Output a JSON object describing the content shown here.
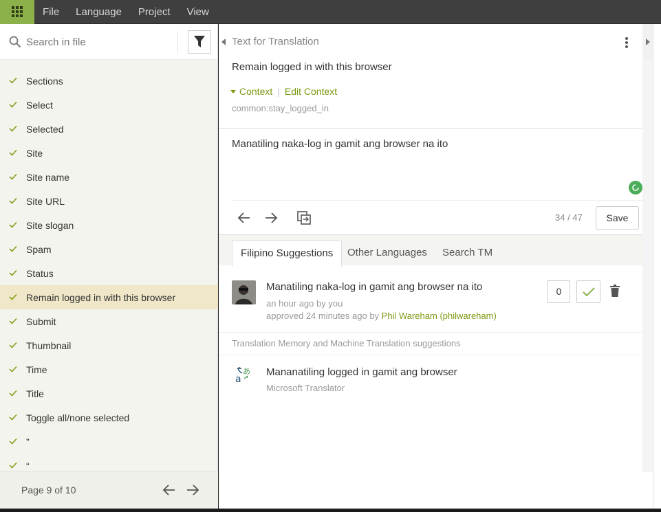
{
  "menubar": {
    "items": [
      "File",
      "Language",
      "Project",
      "View"
    ]
  },
  "sidebar": {
    "search_placeholder": "Search in file",
    "strings": [
      {
        "label": "Sections"
      },
      {
        "label": "Select"
      },
      {
        "label": "Selected"
      },
      {
        "label": "Site"
      },
      {
        "label": "Site name"
      },
      {
        "label": "Site URL"
      },
      {
        "label": "Site slogan"
      },
      {
        "label": "Spam"
      },
      {
        "label": "Status"
      },
      {
        "label": "Remain logged in with this browser",
        "active": true
      },
      {
        "label": "Submit"
      },
      {
        "label": "Thumbnail"
      },
      {
        "label": "Time"
      },
      {
        "label": "Title"
      },
      {
        "label": "Toggle all/none selected"
      },
      {
        "label": "”"
      },
      {
        "label": "“"
      }
    ],
    "pager": {
      "text": "Page 9 of 10"
    }
  },
  "editor": {
    "header": "Text for Translation",
    "source_text": "Remain logged in with this browser",
    "context_label": "Context",
    "edit_context_label": "Edit Context",
    "context_key": "common:stay_logged_in",
    "translation": "Manatiling naka-log in gamit ang browser na ito",
    "counter": "34 / 47",
    "save_label": "Save"
  },
  "tabs": [
    {
      "label": "Filipino Suggestions",
      "active": true
    },
    {
      "label": "Other Languages",
      "active": false
    },
    {
      "label": "Search TM",
      "active": false
    }
  ],
  "suggestion": {
    "text": "Manatiling naka-log in gamit ang browser na ito",
    "meta_time": "an hour ago by you",
    "approved_prefix": "approved 24 minutes ago by ",
    "approved_user": "Phil Wareham (philwareham)",
    "votes": "0"
  },
  "tm": {
    "header": "Translation Memory and Machine Translation suggestions",
    "text": "Mananatiling logged in gamit ang browser",
    "source": "Microsoft Translator"
  },
  "colors": {
    "accent": "#7a9a12",
    "app_button": "#8cb14a",
    "active_row": "#efe7c8",
    "status": "#4cae5b"
  }
}
